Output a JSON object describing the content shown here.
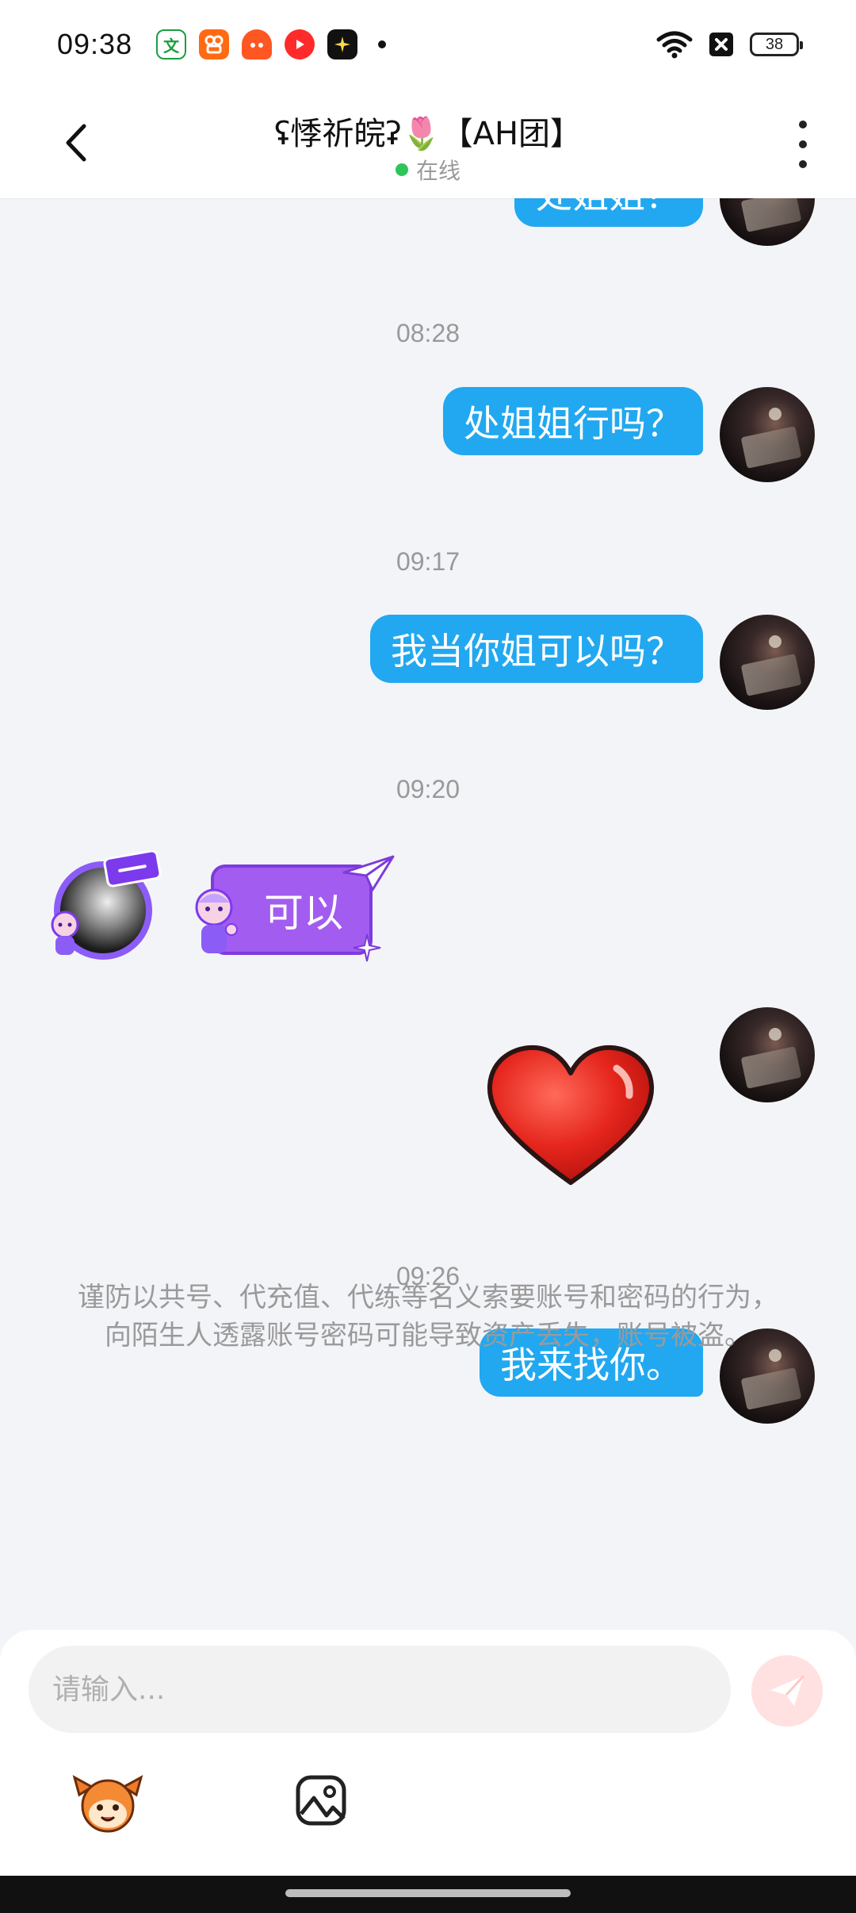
{
  "status_bar": {
    "time": "09:38",
    "battery": "38",
    "notification_icons": [
      "wenxue-app-icon",
      "kuaishou-app-icon",
      "taobao-app-icon",
      "video-app-icon",
      "sparkle-app-icon"
    ]
  },
  "header": {
    "title": "ʢ悸祈皖ʡ🌷【AH团】",
    "status": "在线"
  },
  "messages": {
    "cutoff_text": "处姐姐？",
    "t1": "08:28",
    "m1": "处姐姐行吗？",
    "t2": "09:17",
    "m2": "我当你姐可以吗？",
    "t3": "09:20",
    "in1": "可以",
    "t4": "09:26",
    "m3": "我来找你。"
  },
  "notice": "谨防以共号、代充值、代练等名义索要账号和密码的行为，向陌生人透露账号密码可能导致资产丢失，账号被盗。",
  "input": {
    "placeholder": "请输入..."
  },
  "colors": {
    "outgoing_bubble": "#22a8f0",
    "incoming_bubble": "#a35cf0",
    "online": "#2ec45a",
    "send_button": "#ffe1e1"
  }
}
